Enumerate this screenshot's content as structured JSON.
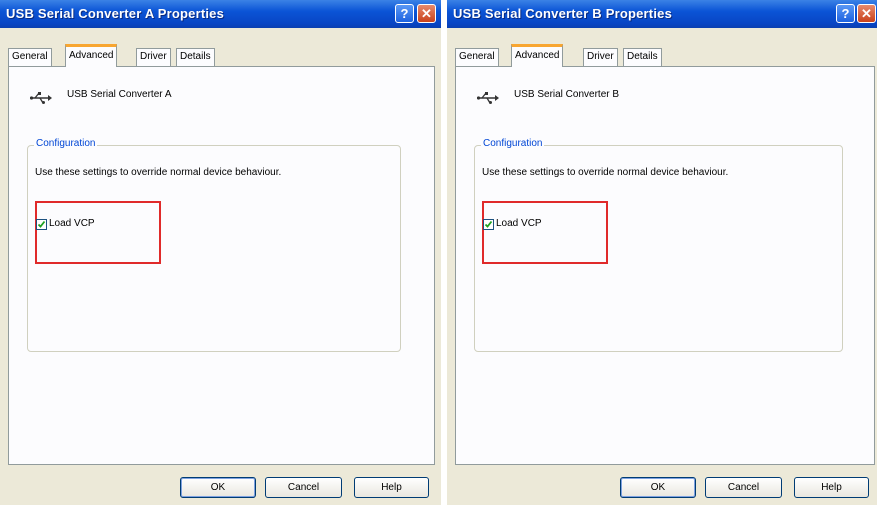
{
  "dialog_a": {
    "title": "USB Serial Converter A Properties",
    "tabs": [
      "General",
      "Advanced",
      "Driver",
      "Details"
    ],
    "device_name": "USB Serial Converter A",
    "group_title": "Configuration",
    "group_desc": "Use these settings to override normal device behaviour.",
    "checkbox_label": "Load VCP",
    "checkbox_checked": true,
    "buttons": {
      "ok": "OK",
      "cancel": "Cancel",
      "help": "Help"
    }
  },
  "dialog_b": {
    "title": "USB Serial Converter B Properties",
    "tabs": [
      "General",
      "Advanced",
      "Driver",
      "Details"
    ],
    "device_name": "USB Serial Converter B",
    "group_title": "Configuration",
    "group_desc": "Use these settings to override normal device behaviour.",
    "checkbox_label": "Load VCP",
    "checkbox_checked": true,
    "buttons": {
      "ok": "OK",
      "cancel": "Cancel",
      "help": "Help"
    }
  },
  "titlebar_buttons": {
    "help": "?",
    "close": "✕"
  },
  "colors": {
    "titlebar": "#0b54d6",
    "highlight": "#e02a2a",
    "tab_accent": "#f8a631",
    "group_title": "#0046d5"
  },
  "icons": {
    "device": "usb-icon",
    "help": "help-icon",
    "close": "close-icon",
    "check": "check-icon"
  }
}
